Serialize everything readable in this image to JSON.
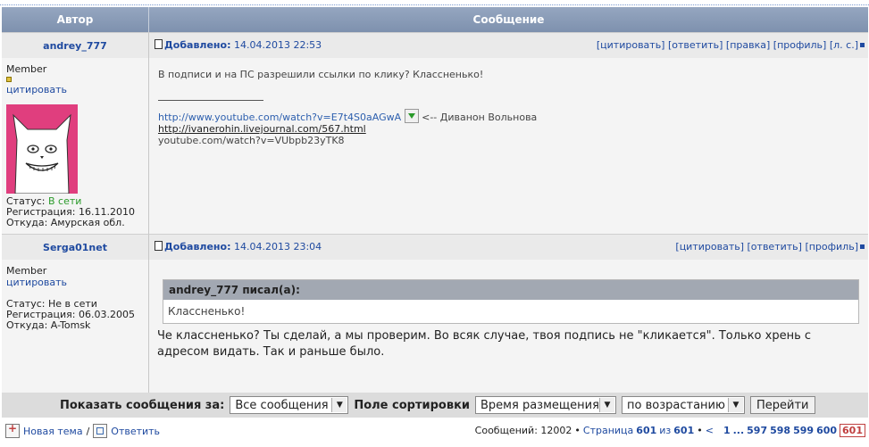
{
  "header": {
    "author_col": "Автор",
    "message_col": "Сообщение"
  },
  "posts": [
    {
      "author": "andrey_777",
      "posted_label": "Добавлено:",
      "posted_date": "14.04.2013 22:53",
      "actions": [
        "[цитировать]",
        "[ответить]",
        "[правка]",
        "[профиль]",
        "[л. с.]"
      ],
      "rank": "Member",
      "quote_link": "цитировать",
      "status_label": "Статус:",
      "status_value": "В сети",
      "reg_label": "Регистрация:",
      "reg_value": "16.11.2010",
      "from_label": "Откуда:",
      "from_value": "Амурская обл.",
      "text": "В подписи и на ПС разрешили ссылки по клику? Классненько!",
      "sig_url1": "http://www.youtube.com/watch?v=E7t4S0aAGwA",
      "sig_text1": "<-- Диванон Вольнова",
      "sig_url2": "http://ivanerohin.livejournal.com/567.html",
      "sig_url3": "youtube.com/watch?v=VUbpb23yTK8"
    },
    {
      "author": "Serga01net",
      "posted_label": "Добавлено:",
      "posted_date": "14.04.2013 23:04",
      "actions": [
        "[цитировать]",
        "[ответить]",
        "[профиль]"
      ],
      "rank": "Member",
      "quote_link": "цитировать",
      "status_label": "Статус:",
      "status_value": "Не в сети",
      "reg_label": "Регистрация:",
      "reg_value": "06.03.2005",
      "from_label": "Откуда:",
      "from_value": "A-Tomsk",
      "quote_head": "andrey_777 писал(а):",
      "quote_body": "Классненько!",
      "text": "Че классненько? Ты сделай, а мы проверим. Во всяк случае, твоя подпись не \"кликается\". Только хрень с адресом видать. Так и раньше было."
    }
  ],
  "bottom_bar": {
    "show_label": "Показать сообщения за:",
    "show_value": "Все сообщения",
    "sort_label": "Поле сортировки",
    "sort_value": "Время размещения",
    "order_value": "по возрастанию",
    "go_button": "Перейти"
  },
  "footer": {
    "new_topic": "Новая тема",
    "separator": "/",
    "reply": "Ответить",
    "messages_label": "Сообщений: 12002",
    "bullet": "•",
    "page_label": "Страница",
    "page_current": "601",
    "page_of": "из",
    "page_total": "601",
    "prev": "<",
    "pages": [
      "1",
      "...",
      "597",
      "598",
      "599",
      "600"
    ],
    "current_page": "601"
  }
}
